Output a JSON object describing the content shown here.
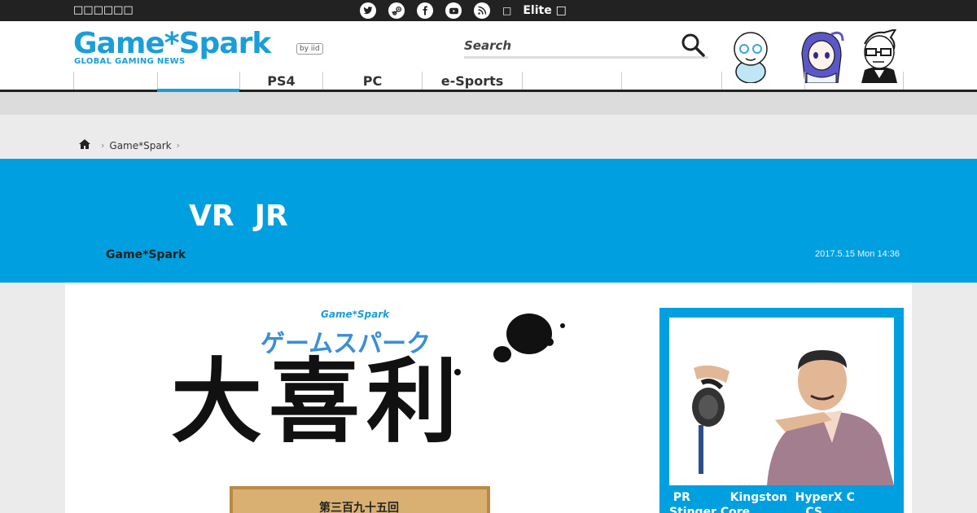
{
  "topbar": {
    "left_text": "□□□□□□",
    "social": [
      "twitter-icon",
      "steam-icon",
      "facebook-icon",
      "youtube-icon",
      "rss-icon"
    ],
    "glyph": "□",
    "elite_label": "Elite □"
  },
  "header": {
    "logo_text": "Game*Spark",
    "logo_sub": "GLOBAL GAMING NEWS",
    "logo_badge": "by iid",
    "search_placeholder": "Search"
  },
  "nav": {
    "items": [
      "",
      "",
      "PS4",
      "PC",
      "e-Sports",
      "",
      "",
      "",
      ""
    ],
    "active_index": 1
  },
  "breadcrumb": {
    "home_icon": "home-icon",
    "site": "Game*Spark",
    "sep": "›"
  },
  "article": {
    "title": "VR  JR",
    "author": "Game*Spark",
    "date": "2017.5.15 Mon 14:36"
  },
  "hero_image": {
    "logo": "Game*Spark",
    "subtitle": "ゲームスパーク",
    "kanji": "大喜利",
    "board_text": "第三百九十五回"
  },
  "sidebar_ad": {
    "caption": " PR          Kingston  HyperX C\nStinger Core              CS"
  },
  "colors": {
    "brand_blue": "#009fe0",
    "topbar": "#222222"
  }
}
